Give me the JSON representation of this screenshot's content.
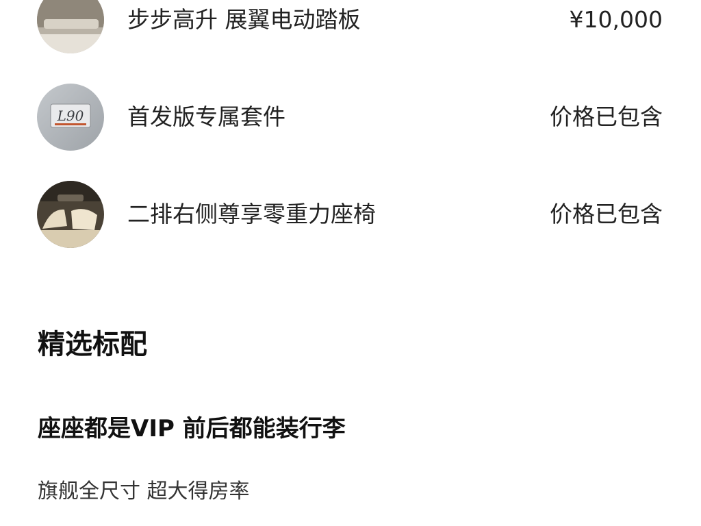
{
  "options": [
    {
      "name": "步步高升 展翼电动踏板",
      "price": "¥10,000",
      "thumb_icon": "running-board-thumbnail"
    },
    {
      "name": "首发版专属套件",
      "price": "价格已包含",
      "thumb_icon": "l90-badge-thumbnail",
      "badge_text": "L90"
    },
    {
      "name": "二排右侧尊享零重力座椅",
      "price": "价格已包含",
      "thumb_icon": "zero-gravity-seat-thumbnail"
    }
  ],
  "section": {
    "title": "精选标配"
  },
  "feature": {
    "title": "座座都是VIP 前后都能装行李",
    "subtitle": "旗舰全尺寸 超大得房率"
  }
}
